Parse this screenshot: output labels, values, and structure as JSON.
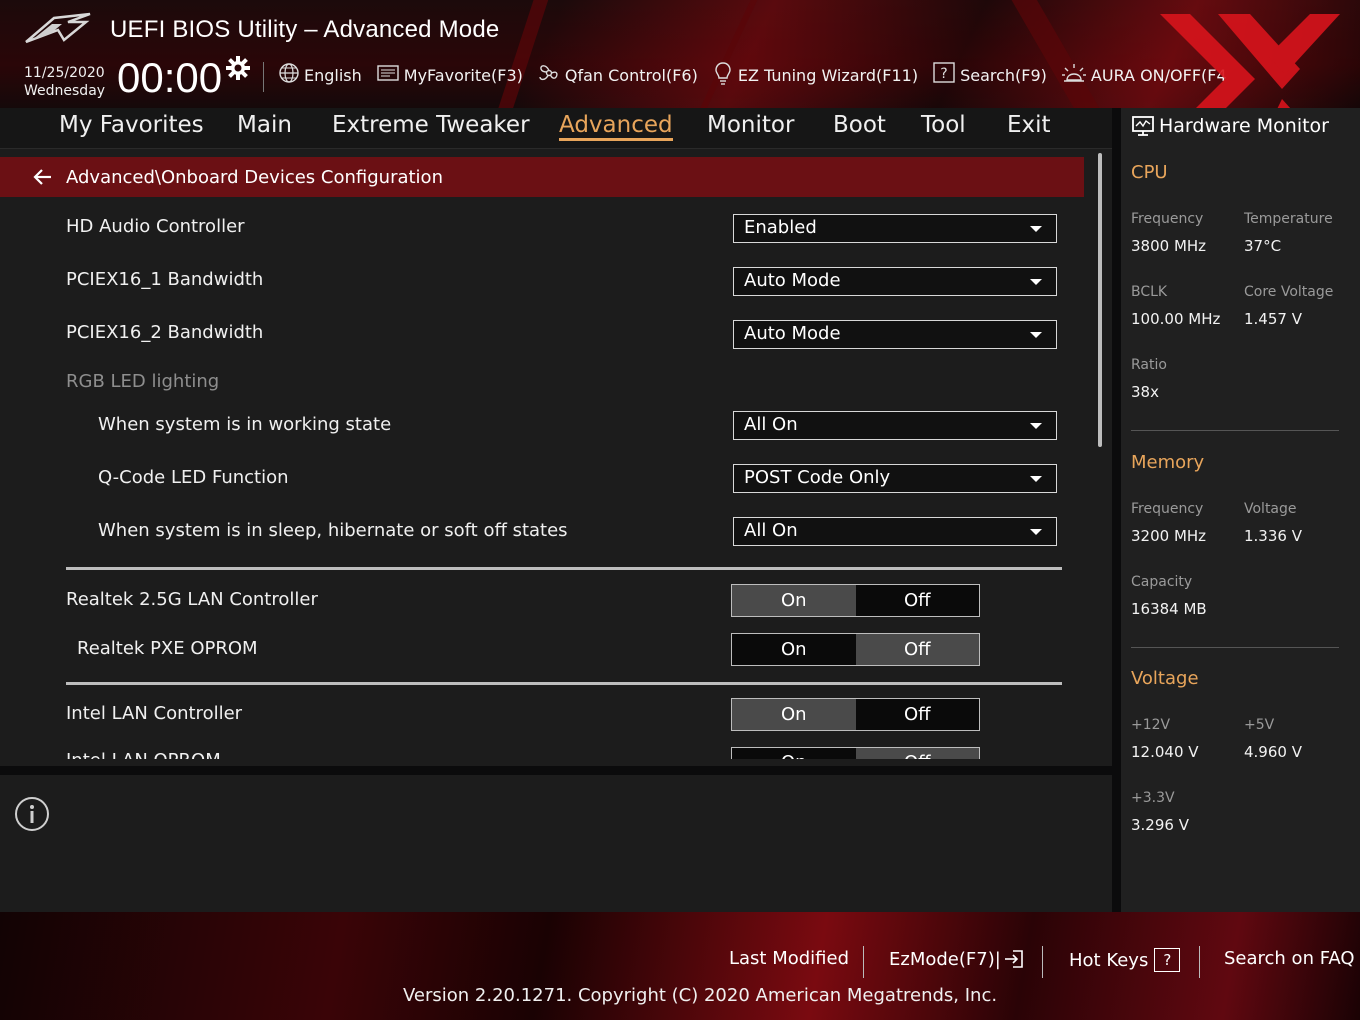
{
  "header": {
    "title": "UEFI BIOS Utility – Advanced Mode",
    "date": "11/25/2020",
    "weekday": "Wednesday",
    "time": "00:00",
    "toolbar": {
      "language": "English",
      "myfavorite": "MyFavorite(F3)",
      "qfan": "Qfan Control(F6)",
      "ez_tuning": "EZ Tuning Wizard(F11)",
      "search": "Search(F9)",
      "aura": "AURA ON/OFF(F4"
    }
  },
  "tabs": [
    "My Favorites",
    "Main",
    "Extreme Tweaker",
    "Advanced",
    "Monitor",
    "Boot",
    "Tool",
    "Exit"
  ],
  "active_tab": "Advanced",
  "breadcrumb": "Advanced\\Onboard Devices Configuration",
  "settings": {
    "hd_audio": {
      "label": "HD Audio Controller",
      "value": "Enabled"
    },
    "pciex16_1": {
      "label": "PCIEX16_1 Bandwidth",
      "value": "Auto Mode"
    },
    "pciex16_2": {
      "label": "PCIEX16_2 Bandwidth",
      "value": "Auto Mode"
    },
    "rgb_header": "RGB LED lighting",
    "working_state": {
      "label": "When system is in working state",
      "value": "All On"
    },
    "qcode": {
      "label": "Q-Code LED Function",
      "value": "POST Code Only"
    },
    "sleep_state": {
      "label": "When system is in sleep, hibernate or soft off states",
      "value": "All On"
    },
    "realtek_lan": {
      "label": "Realtek 2.5G LAN Controller",
      "on": "On",
      "off": "Off",
      "selected": "On"
    },
    "realtek_pxe": {
      "label": "Realtek PXE OPROM",
      "on": "On",
      "off": "Off",
      "selected": "Off"
    },
    "intel_lan": {
      "label": "Intel LAN Controller",
      "on": "On",
      "off": "Off",
      "selected": "On"
    },
    "intel_oprom": {
      "label": "Intel LAN OPROM",
      "on": "On",
      "off": "Off",
      "selected": "Off"
    }
  },
  "hw_monitor": {
    "title": "Hardware Monitor",
    "cpu": {
      "heading": "CPU",
      "frequency_label": "Frequency",
      "frequency": "3800 MHz",
      "temperature_label": "Temperature",
      "temperature": "37°C",
      "bclk_label": "BCLK",
      "bclk": "100.00 MHz",
      "core_voltage_label": "Core Voltage",
      "core_voltage": "1.457 V",
      "ratio_label": "Ratio",
      "ratio": "38x"
    },
    "memory": {
      "heading": "Memory",
      "frequency_label": "Frequency",
      "frequency": "3200 MHz",
      "voltage_label": "Voltage",
      "voltage": "1.336 V",
      "capacity_label": "Capacity",
      "capacity": "16384 MB"
    },
    "voltage": {
      "heading": "Voltage",
      "v12_label": "+12V",
      "v12": "12.040 V",
      "v5_label": "+5V",
      "v5": "4.960 V",
      "v33_label": "+3.3V",
      "v33": "3.296 V"
    }
  },
  "footer": {
    "last_modified": "Last Modified",
    "ezmode": "EzMode(F7)|",
    "hotkeys": "Hot Keys",
    "hotkeys_key": "?",
    "faq": "Search on FAQ",
    "version": "Version 2.20.1271. Copyright (C) 2020 American Megatrends, Inc."
  },
  "colors": {
    "accent": "#e8a55b",
    "breadcrumb_bg": "#6b1014",
    "panel_bg": "#1c1c1c",
    "watermark": "#d8141c"
  },
  "icons": [
    "rog-logo-icon",
    "gear-icon",
    "globe-icon",
    "favorite-icon",
    "fan-icon",
    "bulb-icon",
    "help-search-icon",
    "aura-icon",
    "back-arrow-icon",
    "monitor-icon",
    "info-icon",
    "exit-arrow-icon"
  ]
}
